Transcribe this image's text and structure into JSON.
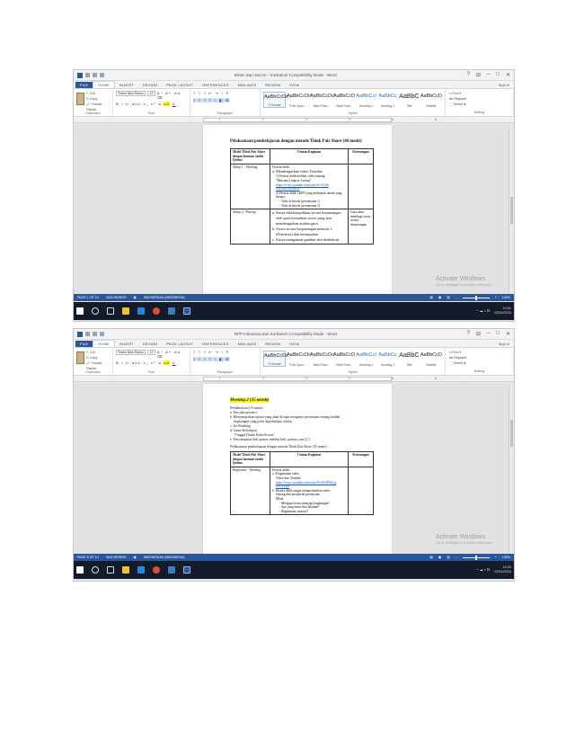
{
  "window": {
    "title": "Bidan Sari Sari Di - Kurikulum Compatibility Mode - Word",
    "title2": "RPP Indonesia dan Kurikulum Compatibility Mode - Word",
    "controls": [
      "?",
      "⊟",
      "–",
      "□",
      "✕"
    ]
  },
  "ribbon": {
    "tabs": [
      "FILE",
      "HOME",
      "INSERT",
      "DESIGN",
      "PAGE LAYOUT",
      "REFERENCES",
      "MAILINGS",
      "REVIEW",
      "VIEW"
    ],
    "signin": "Sign in",
    "clipboard": {
      "items": [
        "✂ Cut",
        "⎘ Copy",
        "🖌 Format Painter"
      ],
      "paste": "Paste",
      "name": "Clipboard"
    },
    "font": {
      "name_value": "Times New Roma",
      "size_value": "12",
      "row1": "A^ A˅ Aa ⌫",
      "row2": "B I U abc x₂ x² A",
      "group_name": "Font"
    },
    "paragraph": {
      "row1": "≡ ≡ ≡ ⇤ ⇥ ↕ ¶",
      "row2": "≡ ≡ ≡ ≡ ↕ ◧ ⊞",
      "group_name": "Paragraph"
    },
    "styles": {
      "items": [
        {
          "preview": "AaBbCcDc",
          "label": "¶ Normal"
        },
        {
          "preview": "AaBbCcDc",
          "label": "¶ No Spac..."
        },
        {
          "preview": "AaBbCcDc",
          "label": "Table Para..."
        },
        {
          "preview": "AaBbCcD",
          "label": "Table Para..."
        },
        {
          "preview": "AaBbCcI",
          "label": "Heading 1"
        },
        {
          "preview": "AaBbCc",
          "label": "Heading 2"
        },
        {
          "preview": "AaBbC",
          "label": "Title"
        },
        {
          "preview": "AaBbCcD",
          "label": "Subtitle"
        }
      ],
      "group_name": "Styles"
    },
    "editing": {
      "items": [
        "⌕ Find ▾",
        "ab Replace",
        "⬚ Select ▾"
      ],
      "group_name": "Editing"
    }
  },
  "ruler": {
    "ticks": "· 1 · · · 2 · · · 3 · · · 4 · · · 5 · · · 6 · · ·"
  },
  "status": {
    "page1": "PAGE 1 OF 14",
    "words1": "3843 WORDS",
    "lang": "INDONESIAN (INDONESIA)",
    "page2": "PAGE 5 OF 14",
    "words2": "3843 WORDS",
    "zoom": "100%"
  },
  "watermark": {
    "line1": "Activate Windows",
    "line2": "Go to Settings to activate Windows."
  },
  "tray": {
    "time1": "10:01",
    "date1": "12/04/2024",
    "time2": "10:02",
    "date2": "12/04/2024"
  },
  "doc1": {
    "heading": "Pelaksanaan pembelajaran dengan metode Think Pair Share (40 menit)",
    "col1_header": "Model Think Pair Share dengan bantuan media Quizizz",
    "col2_header": "Urutan Kegiatan",
    "col3_header": "Keterangan",
    "row1_label": "Tahap 1 - Thinking",
    "row1_lines": [
      "Peserta didik:",
      "a. Mendengarkan video Youtube",
      "1) Peserta didik melihat video tentang",
      "\"Bencana Longsor Lereng\"",
      "https://www.youtube.com/watch?v=Gfm",
      "Y1L2MY0DXKw",
      "2) Peserta didik LKPD yang berbentuk denah yang",
      "berupa:",
      "- Tulis di bawah (pertanyaan 1)",
      "- Tulis di bawah (pertanyaan 2)"
    ],
    "row2_label": "Tahap 2 - Pairing",
    "row2_lines": [
      "a. Siswa dikelompokkan secara berpasangan",
      "oleh guru kemudian siswa yang lain",
      "mendengarkan arahan guru",
      "b. Siswa secara berpasangan menulis 1",
      "(Peristiwa) dan kesimpulan",
      "c. Siswa mengamati gambar dan berdiskusi"
    ],
    "row2_note": "Guru akan membagi siswa secara berpasangan"
  },
  "doc2": {
    "heading": "Meeting 2 (35 menit)",
    "lines": [
      "Pendahuluan (10 menit)",
      "a. Doa dan presensi",
      "b. Menyampaikan tujuan yang akan dicapai mengenai persamaan tentang kaidah",
      "lingkungan yang perlu diperhatikan sekitar",
      "c. Ice Breaking",
      "d. Game Kelompok",
      "\"Tinggal Diatas Pulau Kertas\"",
      "e. Penyampaian link quizizz melalui link: quizizz.com [G]"
    ],
    "sub": "Pelaksanaan pembelajaran dengan metode Think Pair Share (35 menit)",
    "col1_header": "Model Think Pair Share dengan bantuan media Quizizz",
    "col2_header": "Urutan Kegiatan",
    "col3_header": "Keterangan",
    "row1_label": "Eksplorasi - Thinking",
    "row1_lines": [
      "Peserta didik:",
      "a. Pengamatan video",
      "Video dari Youtube",
      "https://www.youtube.com/watch?v=K4DWr1g",
      "4rYOVgw",
      "b. Peserta didik sangat memperhatikan video",
      "tentang dan menjawab pertanyaan",
      "Misal:",
      "- Mengapa harus menjaga lingkungan?",
      "- Apa yang harus kita lakukan?",
      "- Bagaimana caranya?"
    ]
  }
}
